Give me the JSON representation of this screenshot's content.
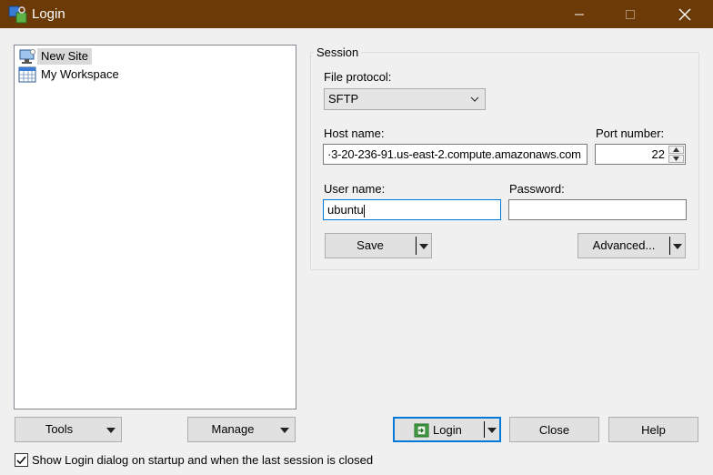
{
  "window": {
    "title": "Login",
    "icons": {
      "app": "winscp-icon",
      "minimize": "minimize-icon",
      "maximize": "maximize-icon",
      "close": "close-icon"
    }
  },
  "sites": [
    {
      "label": "New Site",
      "icon": "new-site-monitor-icon",
      "selected": true
    },
    {
      "label": "My Workspace",
      "icon": "workspace-grid-icon",
      "selected": false
    }
  ],
  "session": {
    "group_label": "Session",
    "file_protocol_label": "File protocol:",
    "file_protocol_value": "SFTP",
    "host_name_label": "Host name:",
    "host_name_value": "·3-20-236-91.us-east-2.compute.amazonaws.com",
    "port_number_label": "Port number:",
    "port_number_value": "22",
    "user_name_label": "User name:",
    "user_name_value": "ubuntu",
    "password_label": "Password:",
    "password_value": "",
    "save_label": "Save",
    "advanced_label": "Advanced..."
  },
  "bottom": {
    "tools_label": "Tools",
    "manage_label": "Manage",
    "login_label": "Login",
    "close_label": "Close",
    "help_label": "Help",
    "startup_checkbox_label": "Show Login dialog on startup and when the last session is closed",
    "startup_checked": true
  },
  "colors": {
    "titlebar": "#6b3a06",
    "focus": "#0078d7",
    "selection": "#d9d9d9"
  }
}
